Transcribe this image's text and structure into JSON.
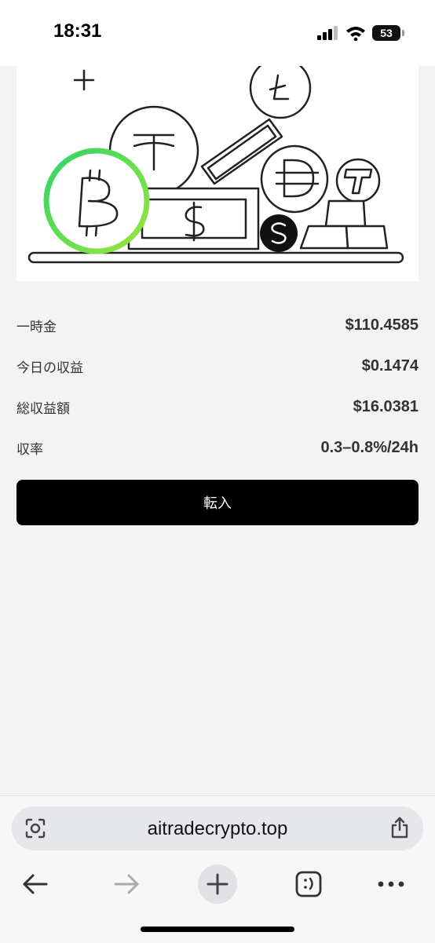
{
  "status_bar": {
    "time": "18:31",
    "battery": "53"
  },
  "hero": {
    "illustration": "crypto-coins-and-cash",
    "accent_color": "#3ccf4e"
  },
  "stats": [
    {
      "label": "一時金",
      "value": "$110.4585"
    },
    {
      "label": "今日の収益",
      "value": "$0.1474"
    },
    {
      "label": "総収益額",
      "value": "$16.0381"
    },
    {
      "label": "収率",
      "value": "0.3–0.8%/24h"
    }
  ],
  "transfer_button": {
    "label": "転入"
  },
  "browser": {
    "url": "aitradecrypto.top",
    "nav_icons": [
      "back-arrow-icon",
      "forward-arrow-icon",
      "new-tab-plus-icon",
      "tabs-icon",
      "more-icon"
    ]
  }
}
